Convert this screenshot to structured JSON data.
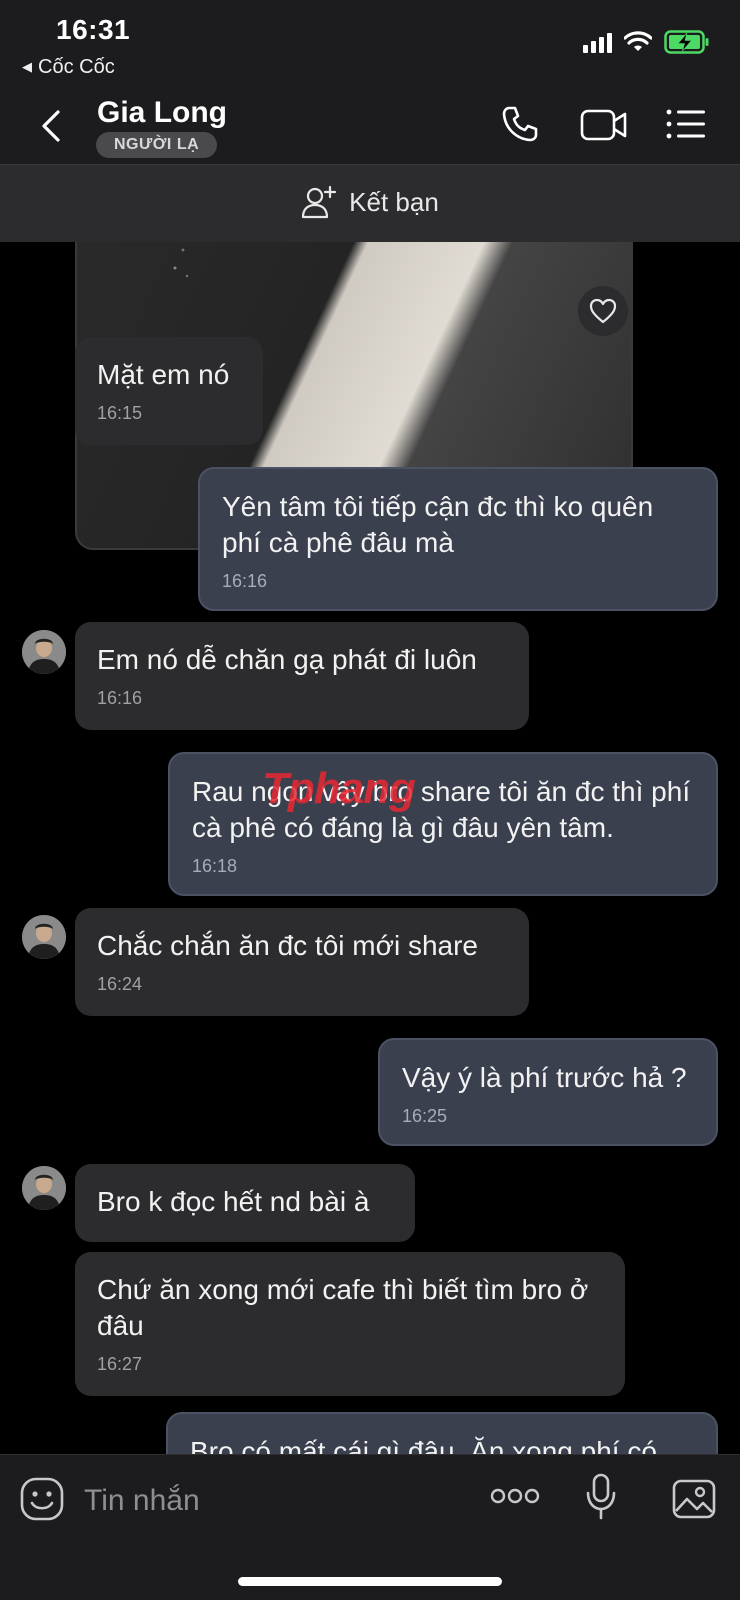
{
  "status_bar": {
    "time": "16:31",
    "back_app": "Cốc Cốc",
    "icons": [
      "cellular-signal-icon",
      "wifi-icon",
      "battery-charging-icon"
    ],
    "battery_color": "#4cd964"
  },
  "header": {
    "contact_name": "Gia Long",
    "badge": "NGƯỜI LẠ",
    "icons": [
      "back-chevron-icon",
      "phone-icon",
      "video-call-icon",
      "menu-list-icon"
    ]
  },
  "add_friend": {
    "label": "Kết bạn",
    "icon": "add-user-icon"
  },
  "messages": [
    {
      "side": "in",
      "text": "Mặt em nó",
      "time": "16:15"
    },
    {
      "side": "out",
      "text": "Yên tâm tôi tiếp cận đc thì ko quên phí cà phê đâu mà",
      "time": "16:16"
    },
    {
      "side": "in",
      "text": "Em nó dễ chăn gạ phát đi luôn",
      "time": "16:16"
    },
    {
      "side": "out",
      "text": "Rau ngon vậy bro share tôi ăn đc thì phí cà phê có đáng là gì đâu yên tâm.",
      "time": "16:18"
    },
    {
      "side": "in",
      "text": "Chắc chắn ăn đc tôi mới share",
      "time": "16:24"
    },
    {
      "side": "out",
      "text": "Vậy ý là phí trước hả ?",
      "time": "16:25"
    },
    {
      "side": "in",
      "text": "Bro k đọc hết nd bài à",
      "time": ""
    },
    {
      "side": "in",
      "text": "Chứ ăn xong mới cafe thì biết tìm bro ở đâu",
      "time": "16:27"
    },
    {
      "side": "out",
      "text": "Bro có mất cái gì đâu. Ăn xong phí có",
      "time": ""
    }
  ],
  "watermark": "Tphang",
  "input_bar": {
    "placeholder": "Tin nhắn",
    "icons": [
      "emoji-icon",
      "more-icon",
      "microphone-icon",
      "image-icon"
    ]
  },
  "colors": {
    "incoming_bubble": "#2c2c2e",
    "outgoing_bubble": "#3a404e",
    "header_bg": "#1c1c1e",
    "watermark": "#e82832"
  }
}
